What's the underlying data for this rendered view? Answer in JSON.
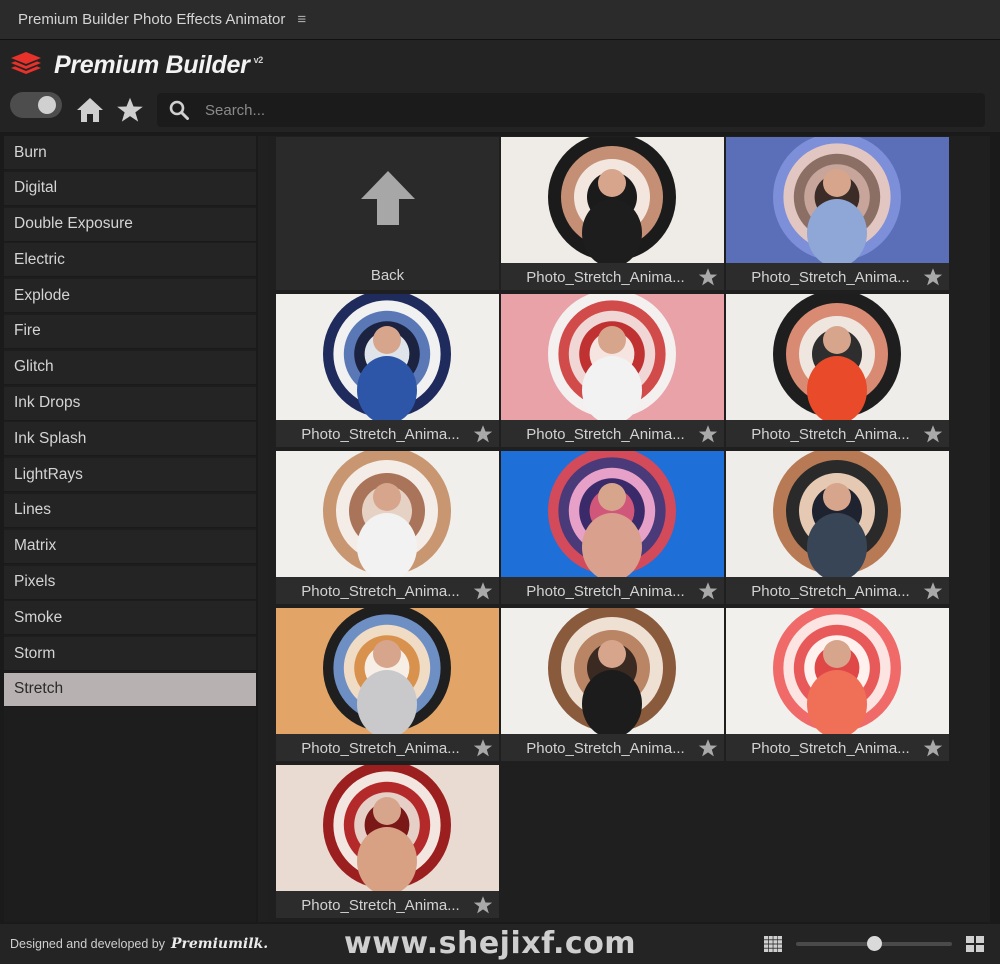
{
  "window": {
    "title": "Premium Builder Photo Effects Animator",
    "menu_icon": "hamburger-icon"
  },
  "brand": {
    "name": "Premium Builder",
    "version": "v2",
    "logo_icon": "stack-layers-icon",
    "logo_color": "#e8312b"
  },
  "toolbar": {
    "toggle_on": true,
    "home_icon": "home-icon",
    "favorites_icon": "star-icon",
    "search_icon": "search-icon",
    "search_placeholder": "Search...",
    "search_value": ""
  },
  "sidebar": {
    "items": [
      {
        "label": "Burn"
      },
      {
        "label": "Digital"
      },
      {
        "label": "Double Exposure"
      },
      {
        "label": "Electric"
      },
      {
        "label": "Explode"
      },
      {
        "label": "Fire"
      },
      {
        "label": "Glitch"
      },
      {
        "label": "Ink Drops"
      },
      {
        "label": "Ink Splash"
      },
      {
        "label": "LightRays"
      },
      {
        "label": "Lines"
      },
      {
        "label": "Matrix"
      },
      {
        "label": "Pixels"
      },
      {
        "label": "Smoke"
      },
      {
        "label": "Storm"
      },
      {
        "label": "Stretch"
      }
    ],
    "active": "Stretch"
  },
  "grid": {
    "back": {
      "label": "Back",
      "icon": "arrow-up-icon"
    },
    "items": [
      {
        "label": "Photo_Stretch_Anima...",
        "bg": "#efebe6",
        "rings": [
          "#1b1b1b",
          "#c58f76",
          "#f2e6de",
          "#1b1b1b"
        ],
        "figure": "#1d1d1d"
      },
      {
        "label": "Photo_Stretch_Anima...",
        "bg": "#5a6fb8",
        "rings": [
          "#7c8fd8",
          "#e2c6c2",
          "#8b6e64",
          "#c7a59b",
          "#3c2c28"
        ],
        "figure": "#8ea7d6"
      },
      {
        "label": "Photo_Stretch_Anima...",
        "bg": "#f1efeb",
        "rings": [
          "#1e2b5c",
          "#f1f1f1",
          "#5b78b6",
          "#1b2340",
          "#dfe3ea"
        ],
        "figure": "#2e56a8"
      },
      {
        "label": "Photo_Stretch_Anima...",
        "bg": "#e9a3a8",
        "rings": [
          "#f3f0ef",
          "#d24b4b",
          "#f0d6d4",
          "#c03232",
          "#f5e4e0"
        ],
        "figure": "#f2f2f2"
      },
      {
        "label": "Photo_Stretch_Anima...",
        "bg": "#efedea",
        "rings": [
          "#1e1e1e",
          "#d88a72",
          "#efe6e0",
          "#2e2e2e"
        ],
        "figure": "#e84a2a"
      },
      {
        "label": "Photo_Stretch_Anima...",
        "bg": "#f0efec",
        "rings": [
          "#c89670",
          "#f4ece6",
          "#a9745a",
          "#e6d2c4"
        ],
        "figure": "#f2f2f2"
      },
      {
        "label": "Photo_Stretch_Anima...",
        "bg": "#1e6fd8",
        "rings": [
          "#d34a5a",
          "#4a3a7a",
          "#e7a1c9",
          "#3a2a6a",
          "#d0567a"
        ],
        "figure": "#d9a08e"
      },
      {
        "label": "Photo_Stretch_Anima...",
        "bg": "#efede9",
        "rings": [
          "#b87a55",
          "#2a2a2a",
          "#e5c9b3",
          "#1f2330"
        ],
        "figure": "#374556"
      },
      {
        "label": "Photo_Stretch_Anima...",
        "bg": "#e3a567",
        "rings": [
          "#1f1f1f",
          "#6e8fc4",
          "#f0dcc4",
          "#d8924e",
          "#f7efe6"
        ],
        "figure": "#c9c9cc"
      },
      {
        "label": "Photo_Stretch_Anima...",
        "bg": "#f1efec",
        "rings": [
          "#8a5a3c",
          "#efe0d4",
          "#b98564",
          "#3a2a22"
        ],
        "figure": "#1c1c1c"
      },
      {
        "label": "Photo_Stretch_Anima...",
        "bg": "#f2f0ed",
        "rings": [
          "#f06a6a",
          "#fbe4e2",
          "#e85a5a",
          "#fff1ee",
          "#e04848"
        ],
        "figure": "#f07057"
      },
      {
        "label": "Photo_Stretch_Anima...",
        "bg": "#e9dad2",
        "rings": [
          "#9c1f20",
          "#f3e6e1",
          "#b42a2a",
          "#e5cfc7",
          "#7a1818"
        ],
        "figure": "#d9a184"
      }
    ],
    "favorite_icon": "star-icon"
  },
  "footer": {
    "credit": "Designed and developed by",
    "logo_text": "Premiumilk.",
    "watermark": "www.shejixf.com",
    "thumbnail_size": 0.5,
    "small_grid_icon": "grid-small-icon",
    "large_grid_icon": "grid-large-icon"
  }
}
